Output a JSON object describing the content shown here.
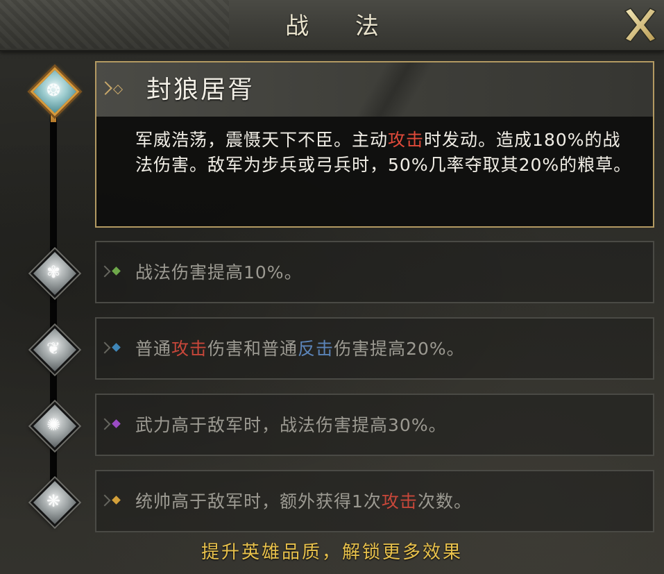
{
  "header": {
    "title": "战 法"
  },
  "skill": {
    "name": "封狼居胥",
    "desc_part1": "军威浩荡，震慑天下不臣。主动",
    "desc_hl1": "攻击",
    "desc_part2": "时发动。造成180%的战法伤害。敌军为步兵或弓兵时，50%几率夺取其20%的粮草。"
  },
  "effects": [
    {
      "text": "战法伤害提高10%。",
      "bullet_color": "#6ea84a"
    },
    {
      "t1": "普通",
      "h1": "攻击",
      "t2": "伤害和普通",
      "h2": "反击",
      "t3": "伤害提高20%。",
      "bullet_color": "#3f86b8"
    },
    {
      "text": "武力高于敌军时，战法伤害提高30%。",
      "bullet_color": "#9b4bc4"
    },
    {
      "t1": "统帅高于敌军时，额外获得1次",
      "h1": "攻击",
      "t2": "次数。",
      "bullet_color": "#d3a03a"
    }
  ],
  "footer": {
    "text": "提升英雄品质，解锁更多效果"
  }
}
